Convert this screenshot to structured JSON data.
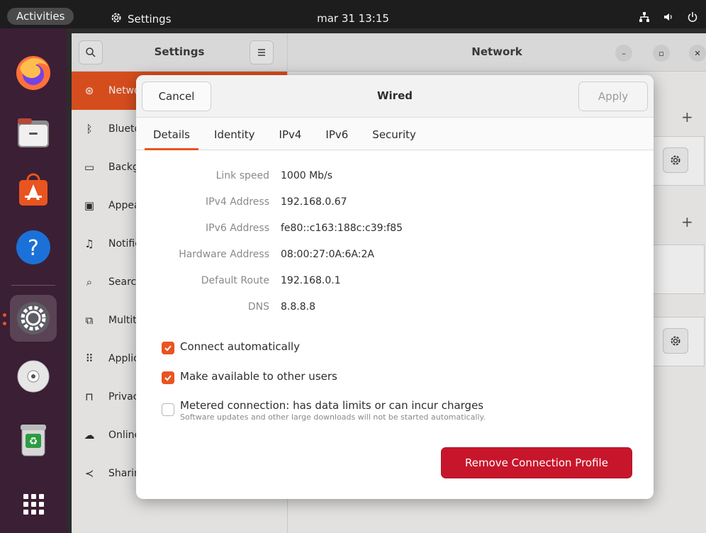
{
  "topbar": {
    "activities": "Activities",
    "app_name": "Settings",
    "clock": "mar 31  13:15"
  },
  "dock": {
    "apps": [
      "firefox-icon",
      "files-icon",
      "app-center-icon",
      "help-icon",
      "settings-icon",
      "dvd-icon",
      "trash-icon",
      "show-apps-icon"
    ]
  },
  "settings": {
    "sidebar_title": "Settings",
    "content_title": "Network",
    "sidebar_items": [
      {
        "label": "Network",
        "icon": "network-icon"
      },
      {
        "label": "Bluetooth",
        "icon": "bluetooth-icon"
      },
      {
        "label": "Background",
        "icon": "background-icon"
      },
      {
        "label": "Appearance",
        "icon": "appearance-icon"
      },
      {
        "label": "Notifications",
        "icon": "bell-icon"
      },
      {
        "label": "Search",
        "icon": "search-icon"
      },
      {
        "label": "Multitasking",
        "icon": "multitasking-icon"
      },
      {
        "label": "Applications",
        "icon": "apps-icon"
      },
      {
        "label": "Privacy",
        "icon": "lock-icon"
      },
      {
        "label": "Online Accounts",
        "icon": "cloud-icon"
      },
      {
        "label": "Sharing",
        "icon": "share-icon"
      }
    ]
  },
  "dialog": {
    "title": "Wired",
    "cancel": "Cancel",
    "apply": "Apply",
    "tabs": [
      "Details",
      "Identity",
      "IPv4",
      "IPv6",
      "Security"
    ],
    "active_tab": "Details",
    "details": [
      {
        "label": "Link speed",
        "value": "1000 Mb/s"
      },
      {
        "label": "IPv4 Address",
        "value": "192.168.0.67"
      },
      {
        "label": "IPv6 Address",
        "value": "fe80::c163:188c:c39:f85"
      },
      {
        "label": "Hardware Address",
        "value": "08:00:27:0A:6A:2A"
      },
      {
        "label": "Default Route",
        "value": "192.168.0.1"
      },
      {
        "label": "DNS",
        "value": "8.8.8.8"
      }
    ],
    "checks": [
      {
        "label": "Connect automatically",
        "checked": true
      },
      {
        "label": "Make available to other users",
        "checked": true
      },
      {
        "label": "Metered connection: has data limits or can incur charges",
        "sub": "Software updates and other large downloads will not be started automatically.",
        "checked": false
      }
    ],
    "remove": "Remove Connection Profile"
  },
  "colors": {
    "accent": "#e95420",
    "danger": "#c7162b"
  }
}
